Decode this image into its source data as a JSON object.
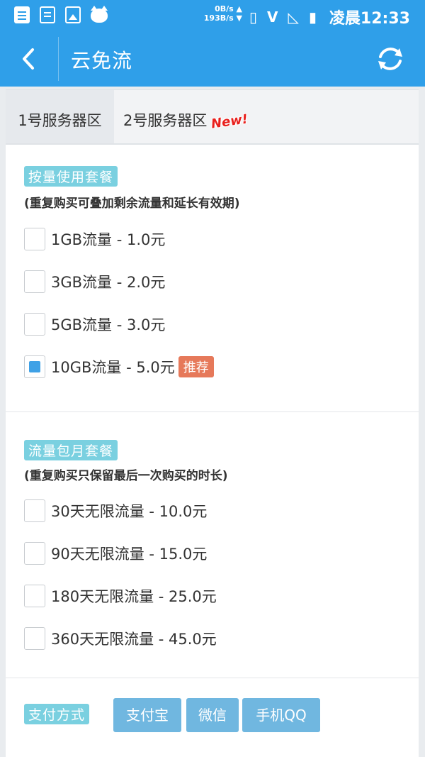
{
  "status_bar": {
    "net_up": "0B/s",
    "net_down": "193B/s",
    "time": "凌晨12:33"
  },
  "app_bar": {
    "title": "云免流"
  },
  "tabs": [
    {
      "label": "1号服务器区"
    },
    {
      "label": "2号服务器区",
      "badge": "New!"
    }
  ],
  "usage_plans": {
    "tag": "按量使用套餐",
    "note": "(重复购买可叠加剩余流量和延长有效期)",
    "options": [
      {
        "label": "1GB流量 - 1.0元",
        "checked": false
      },
      {
        "label": "3GB流量 - 2.0元",
        "checked": false
      },
      {
        "label": "5GB流量 - 3.0元",
        "checked": false
      },
      {
        "label": "10GB流量 - 5.0元",
        "checked": true,
        "badge": "推荐"
      }
    ]
  },
  "monthly_plans": {
    "tag": "流量包月套餐",
    "note": "(重复购买只保留最后一次购买的时长)",
    "options": [
      {
        "label": "30天无限流量 - 10.0元",
        "checked": false
      },
      {
        "label": "90天无限流量 - 15.0元",
        "checked": false
      },
      {
        "label": "180天无限流量 - 25.0元",
        "checked": false
      },
      {
        "label": "360天无限流量 - 45.0元",
        "checked": false
      }
    ]
  },
  "payment": {
    "tag": "支付方式",
    "methods": [
      "支付宝",
      "微信",
      "手机QQ"
    ]
  },
  "colors": {
    "primary": "#2f9fe9",
    "tag_bg": "#7ad0e0",
    "recommend": "#e6795a",
    "pay_button": "#70b7e0"
  }
}
